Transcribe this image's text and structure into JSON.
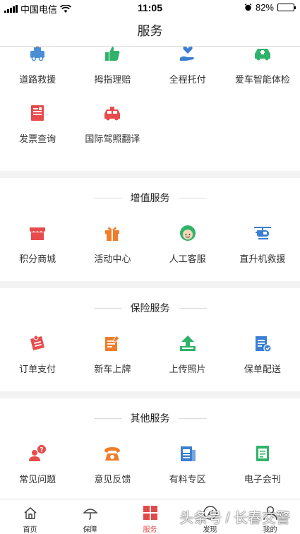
{
  "status": {
    "carrier": "中国电信",
    "time": "11:05",
    "battery": "82%",
    "battery_level": 0.82
  },
  "nav": {
    "title": "服务"
  },
  "top_items": [
    {
      "label": "道路救援",
      "icon": "tow-truck-icon",
      "color": "#4a8fd6"
    },
    {
      "label": "拇指理赔",
      "icon": "thumbs-up-icon",
      "color": "#2fb36a"
    },
    {
      "label": "全程托付",
      "icon": "hand-heart-icon",
      "color": "#3a7fd1"
    },
    {
      "label": "爱车智能体检",
      "icon": "car-check-icon",
      "color": "#2fb36a"
    },
    {
      "label": "发票查询",
      "icon": "invoice-icon",
      "color": "#e84b4b"
    },
    {
      "label": "国际驾照翻译",
      "icon": "taxi-icon",
      "color": "#e84b4b"
    }
  ],
  "sections": [
    {
      "title": "增值服务",
      "items": [
        {
          "label": "积分商城",
          "icon": "shop-icon",
          "color": "#e84b4b"
        },
        {
          "label": "活动中心",
          "icon": "gift-icon",
          "color": "#f07d2a"
        },
        {
          "label": "人工客服",
          "icon": "agent-icon",
          "color": "#2fb36a"
        },
        {
          "label": "直升机救援",
          "icon": "helicopter-icon",
          "color": "#3a7fd1"
        }
      ]
    },
    {
      "title": "保险服务",
      "items": [
        {
          "label": "订单支付",
          "icon": "order-pay-icon",
          "color": "#e84b4b"
        },
        {
          "label": "新车上牌",
          "icon": "edit-doc-icon",
          "color": "#f07d2a"
        },
        {
          "label": "上传照片",
          "icon": "upload-icon",
          "color": "#2fb36a"
        },
        {
          "label": "保单配送",
          "icon": "policy-delivery-icon",
          "color": "#3a7fd1"
        }
      ]
    },
    {
      "title": "其他服务",
      "items": [
        {
          "label": "常见问题",
          "icon": "faq-icon",
          "color": "#e84b4b"
        },
        {
          "label": "意见反馈",
          "icon": "phone-icon",
          "color": "#f07d2a"
        },
        {
          "label": "有料专区",
          "icon": "news-icon",
          "color": "#3a7fd1"
        },
        {
          "label": "电子会刊",
          "icon": "ebook-icon",
          "color": "#2fb36a"
        }
      ]
    }
  ],
  "tabs": [
    {
      "label": "首页",
      "icon": "home-icon",
      "active": false
    },
    {
      "label": "保障",
      "icon": "umbrella-icon",
      "active": false
    },
    {
      "label": "服务",
      "icon": "grid-icon",
      "active": true
    },
    {
      "label": "发现",
      "icon": "compass-icon",
      "active": false
    },
    {
      "label": "我的",
      "icon": "user-icon",
      "active": false
    }
  ],
  "watermark": "头条号 / 长春交警",
  "accent": "#e04a4a"
}
